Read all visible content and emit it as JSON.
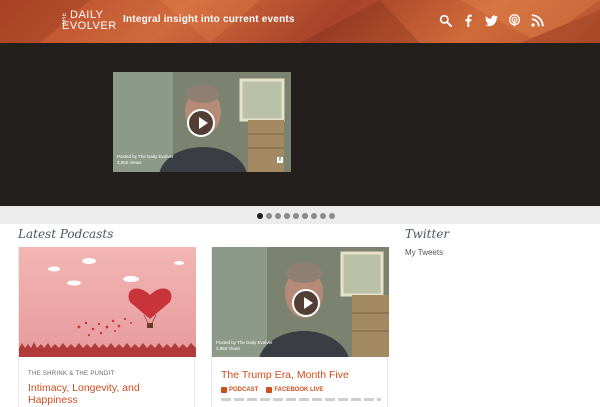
{
  "header": {
    "logo": {
      "the": "THE",
      "daily": "DAILY",
      "evolver": "EVOLVER"
    },
    "tagline": "Integral insight into current events",
    "icons": [
      "search-icon",
      "facebook-icon",
      "twitter-icon",
      "podcast-icon",
      "rss-icon"
    ],
    "accent": "#c85a35"
  },
  "slider": {
    "video": {
      "posted_by": "Posted by The Daily Evolver",
      "views": "3,950 Views",
      "fb_glyph": "f"
    },
    "dots_count": 9,
    "active_dot": 0
  },
  "main": {
    "latest_title": "Latest Podcasts",
    "cards": [
      {
        "kicker": "THE SHRINK & THE PUNDIT",
        "title": "Intimacy, Longevity, and Happiness"
      },
      {
        "title": "The Trump Era, Month Five",
        "video": {
          "posted_by": "Posted by The Daily Evolver",
          "views": "3,950 Views"
        },
        "tags": [
          "PODCAST",
          "FACEBOOK LIVE"
        ]
      }
    ]
  },
  "sidebar": {
    "title": "Twitter",
    "link": "My Tweets"
  },
  "colors": {
    "link": "#cf4e1e",
    "slider_bg": "#231f1c",
    "heading": "#4a5860"
  }
}
